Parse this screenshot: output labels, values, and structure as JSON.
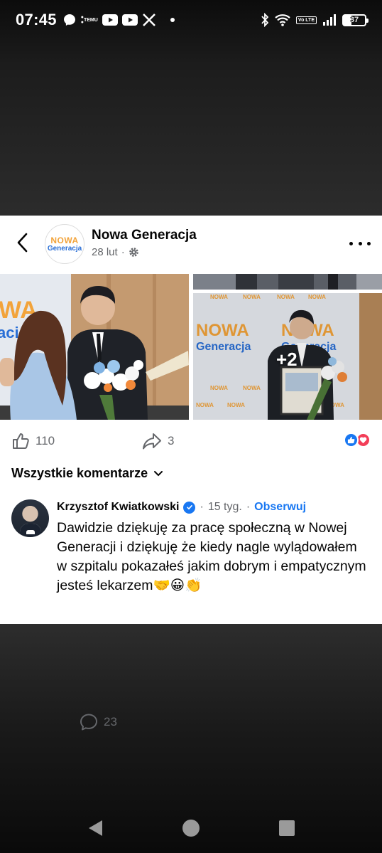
{
  "status_bar": {
    "time": "07:45",
    "temu_label": "TEMU",
    "volte_label": "Vo LTE",
    "battery_level": "37"
  },
  "post": {
    "page_name": "Nowa Generacja",
    "logo_top": "NOWA",
    "logo_bottom": "Generacja",
    "date": "28 lut",
    "more_photos": "+2",
    "likes_count": "110",
    "comments_count": "23",
    "shares_count": "3"
  },
  "comments": {
    "filter_label": "Wszystkie komentarze",
    "items": [
      {
        "author": "Krzysztof Kwiatkowski",
        "time": "15 tyg.",
        "follow_label": "Obserwuj",
        "text": "Dawidzie dziękuję za pracę społeczną w Nowej Generacji i dziękuję że kiedy nagle wylądowałem w szpitalu pokazałeś jakim dobrym i empatycznym jesteś lekarzem🤝😀👏"
      }
    ]
  },
  "colors": {
    "accent": "#1877f2",
    "love": "#f33e58",
    "secondary_text": "#65676b"
  },
  "icons": [
    "back-arrow-icon",
    "gear-icon",
    "more-icon",
    "like-icon",
    "comment-icon",
    "share-icon",
    "chevron-down-icon",
    "verified-icon",
    "nav-back-icon",
    "nav-home-icon",
    "nav-recent-icon"
  ]
}
